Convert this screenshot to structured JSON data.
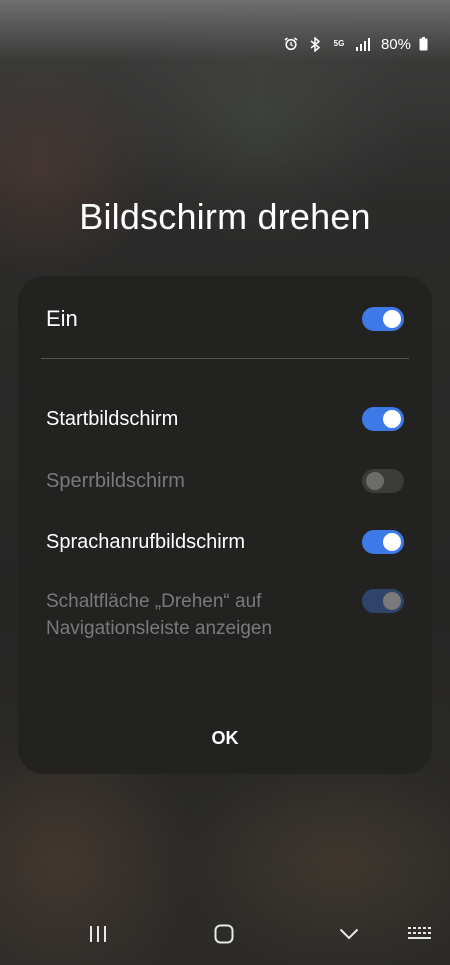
{
  "status_bar": {
    "icons": [
      "alarm-icon",
      "bluetooth-icon",
      "5g-icon",
      "signal-icon",
      "battery-icon"
    ],
    "network": "5G",
    "battery": "80%"
  },
  "title": "Bildschirm drehen",
  "dialog": {
    "main_toggle": {
      "label": "Ein",
      "state": "on"
    },
    "options": [
      {
        "label": "Startbildschirm",
        "state": "on",
        "enabled": true
      },
      {
        "label": "Sperrbildschirm",
        "state": "off",
        "enabled": false
      },
      {
        "label": "Sprachanrufbildschirm",
        "state": "on",
        "enabled": true
      },
      {
        "label": "Schaltfläche „Drehen“ auf Navigationsleiste anzeigen",
        "state": "on",
        "enabled": false
      }
    ],
    "ok_label": "OK"
  },
  "nav_bar": {
    "buttons": [
      "recents-icon",
      "home-icon",
      "back-icon",
      "keyboard-icon"
    ]
  },
  "colors": {
    "accent": "#3e79e8",
    "dialog_bg": "#222221",
    "disabled_text": "#7a7a7a"
  }
}
